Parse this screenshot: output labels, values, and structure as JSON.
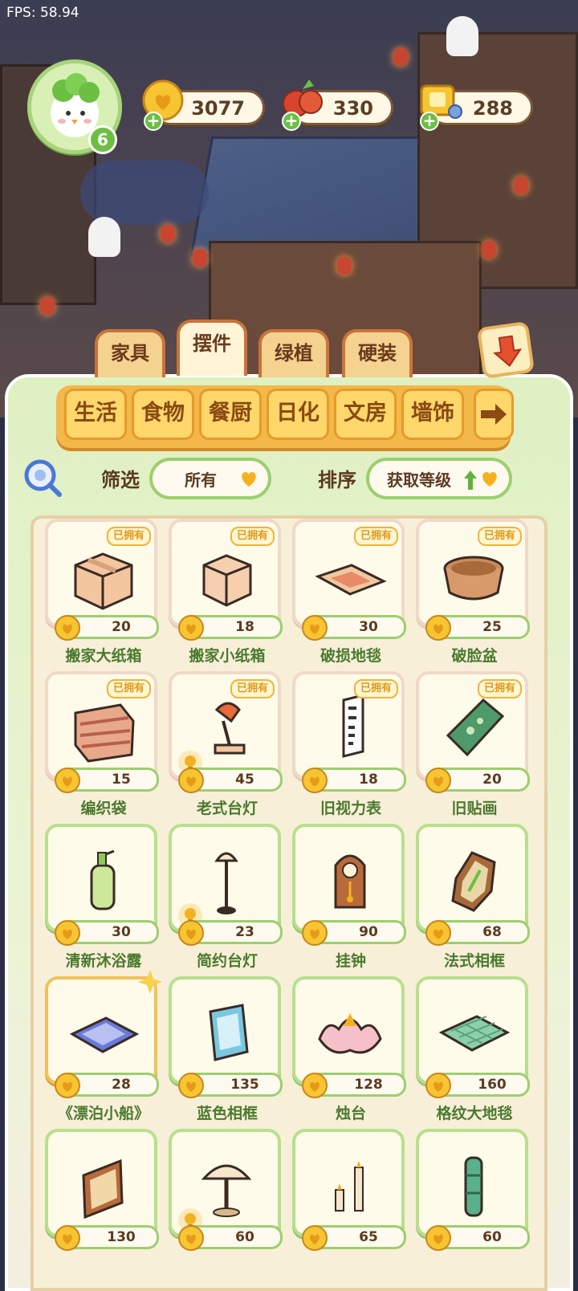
{
  "fps": "FPS: 58.94",
  "player": {
    "level": "6",
    "icon": "sprout-chick-avatar"
  },
  "resources": [
    {
      "name": "coins",
      "value": "3077",
      "icon": "heart-coin-icon"
    },
    {
      "name": "vegetables",
      "value": "330",
      "icon": "radish-icon"
    },
    {
      "name": "tickets",
      "value": "288",
      "icon": "gold-ticket-icon"
    }
  ],
  "category_tabs": [
    {
      "label": "家具"
    },
    {
      "label": "摆件"
    },
    {
      "label": "绿植"
    },
    {
      "label": "硬装"
    }
  ],
  "active_category": "摆件",
  "sub_tabs": [
    {
      "label": "生活"
    },
    {
      "label": "食物"
    },
    {
      "label": "餐厨"
    },
    {
      "label": "日化"
    },
    {
      "label": "文房"
    },
    {
      "label": "墙饰"
    }
  ],
  "filter": {
    "label": "筛选",
    "value": "所有"
  },
  "sort": {
    "label": "排序",
    "value": "获取等级"
  },
  "owned_label": "已拥有",
  "items": [
    {
      "name": "搬家大纸箱",
      "price": "20",
      "owned": true,
      "art": "big-box"
    },
    {
      "name": "搬家小纸箱",
      "price": "18",
      "owned": true,
      "art": "small-box"
    },
    {
      "name": "破损地毯",
      "price": "30",
      "owned": true,
      "art": "rug"
    },
    {
      "name": "破脸盆",
      "price": "25",
      "owned": true,
      "art": "basin"
    },
    {
      "name": "编织袋",
      "price": "15",
      "owned": true,
      "art": "bag"
    },
    {
      "name": "老式台灯",
      "price": "45",
      "owned": true,
      "art": "desk-lamp",
      "bulb": true
    },
    {
      "name": "旧视力表",
      "price": "18",
      "owned": true,
      "art": "eye-chart"
    },
    {
      "name": "旧贴画",
      "price": "20",
      "owned": true,
      "art": "poster"
    },
    {
      "name": "清新沐浴露",
      "price": "30",
      "owned": false,
      "art": "bottle"
    },
    {
      "name": "简约台灯",
      "price": "23",
      "owned": false,
      "art": "floor-lamp",
      "bulb": true
    },
    {
      "name": "挂钟",
      "price": "90",
      "owned": false,
      "art": "clock"
    },
    {
      "name": "法式相框",
      "price": "68",
      "owned": false,
      "art": "frame-leaf"
    },
    {
      "name": "《漂泊小船》",
      "price": "28",
      "owned": false,
      "art": "book",
      "special": true
    },
    {
      "name": "蓝色相框",
      "price": "135",
      "owned": false,
      "art": "blue-frame"
    },
    {
      "name": "烛台",
      "price": "128",
      "owned": false,
      "art": "candle-flower"
    },
    {
      "name": "格纹大地毯",
      "price": "160",
      "owned": false,
      "art": "check-rug"
    },
    {
      "name": "",
      "price": "130",
      "owned": false,
      "art": "mirror"
    },
    {
      "name": "",
      "price": "60",
      "owned": false,
      "art": "mushroom-lamp",
      "bulb": true
    },
    {
      "name": "",
      "price": "65",
      "owned": false,
      "art": "candles"
    },
    {
      "name": "",
      "price": "60",
      "owned": false,
      "art": "bamboo-vase"
    }
  ]
}
